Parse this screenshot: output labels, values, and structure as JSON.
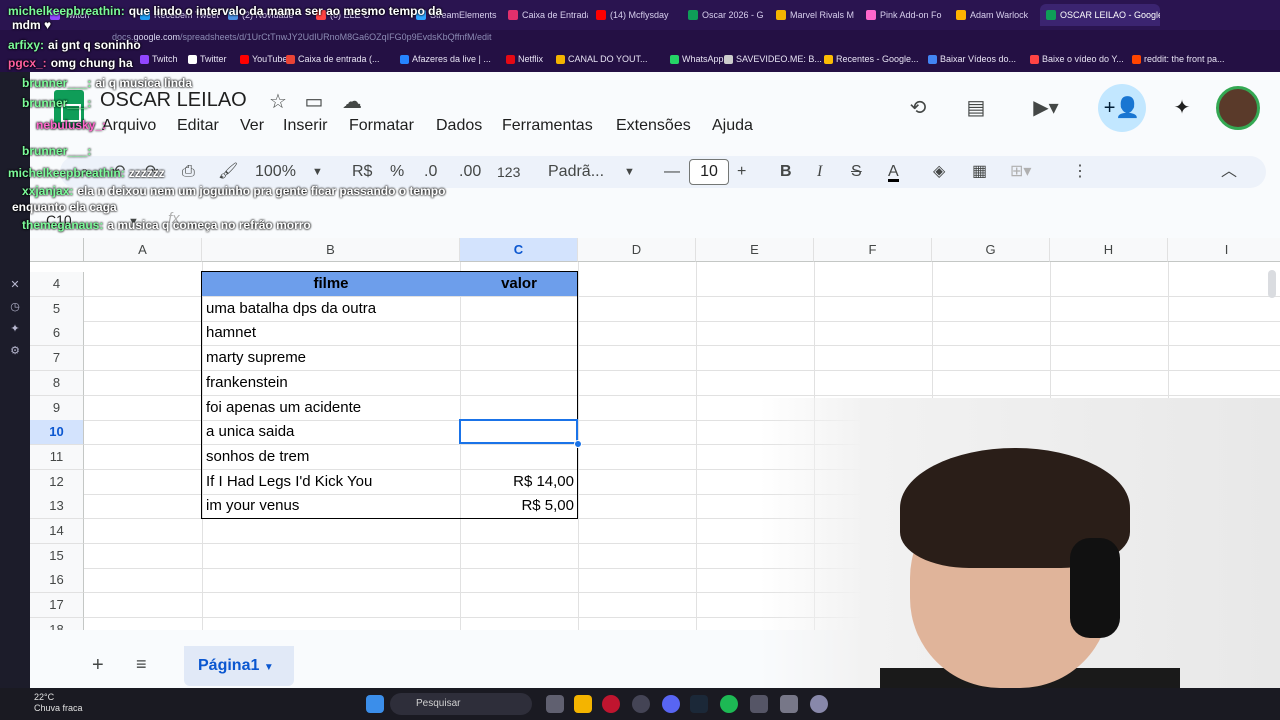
{
  "browser": {
    "tabs": [
      {
        "label": "Twitch",
        "color": "#9146ff"
      },
      {
        "label": "Recebem Tweet",
        "color": "#1d9bf0"
      },
      {
        "label": "(2) Novidade",
        "color": "#4a90e2"
      },
      {
        "label": "(6) ELE C",
        "color": "#ff4444"
      },
      {
        "label": "StreamElements",
        "color": "#2fa5ff"
      },
      {
        "label": "Caixa de Entrada",
        "color": "#e1306c"
      },
      {
        "label": "(14) Mcflysday",
        "color": "#ff0000"
      },
      {
        "label": "Oscar 2026 - G",
        "color": "#0f9d58"
      },
      {
        "label": "Marvel Rivals M",
        "color": "#f4b400"
      },
      {
        "label": "Pink Add-on Fo",
        "color": "#ff66cc"
      },
      {
        "label": "Adam Warlock",
        "color": "#ffb300"
      },
      {
        "label": "OSCAR LEILAO - Google",
        "color": "#0f9d58"
      }
    ],
    "url_prefix": "docs.",
    "url_domain": "google.com",
    "url_path": "/spreadsheets/d/1UrCtTnwJY2UdIURnoM8Ga6OZqIFG0p9EvdsKbQffnfM/edit",
    "bookmarks": [
      {
        "label": "Twitch",
        "color": "#9146ff"
      },
      {
        "label": "Twitter",
        "color": "#ffffff"
      },
      {
        "label": "YouTube",
        "color": "#ff0000"
      },
      {
        "label": "Caixa de entrada (...",
        "color": "#ea4335"
      },
      {
        "label": "Afazeres da live | ...",
        "color": "#2684ff"
      },
      {
        "label": "Netflix",
        "color": "#e50914"
      },
      {
        "label": "CANAL DO YOUT...",
        "color": "#f4b400"
      },
      {
        "label": "WhatsApp",
        "color": "#25d366"
      },
      {
        "label": "SAVEVIDEO.ME: B...",
        "color": "#cccccc"
      },
      {
        "label": "Recentes - Google...",
        "color": "#fbbc04"
      },
      {
        "label": "Baixar Vídeos do...",
        "color": "#4285f4"
      },
      {
        "label": "Baixe o vídeo do Y...",
        "color": "#ff4444"
      },
      {
        "label": "reddit: the front pa...",
        "color": "#ff4500"
      }
    ]
  },
  "sheets": {
    "title": "OSCAR LEILAO",
    "menu": [
      "Arquivo",
      "Editar",
      "Ver",
      "Inserir",
      "Formatar",
      "Dados",
      "Ferramentas",
      "Extensões",
      "Ajuda"
    ],
    "toolbar": {
      "zoom": "100%",
      "currency": "R$",
      "percent": "%",
      "dec_less": ".0",
      "dec_more": ".00",
      "number_fmt": "123",
      "font": "Padrã...",
      "font_size": "10"
    },
    "name_box": "C10",
    "fx": "fx",
    "columns": [
      "A",
      "B",
      "C",
      "D",
      "E",
      "F",
      "G",
      "H",
      "I"
    ],
    "selected_column": "C",
    "rows": [
      "4",
      "5",
      "6",
      "7",
      "8",
      "9",
      "10",
      "11",
      "12",
      "13",
      "14",
      "15",
      "16",
      "17",
      "18"
    ],
    "selected_row": "10",
    "table_header": {
      "filme": "filme",
      "valor": "valor"
    },
    "table_rows": [
      {
        "filme": "uma batalha dps da outra",
        "valor": ""
      },
      {
        "filme": "hamnet",
        "valor": ""
      },
      {
        "filme": "marty supreme",
        "valor": ""
      },
      {
        "filme": "frankenstein",
        "valor": ""
      },
      {
        "filme": "foi apenas um acidente",
        "valor": ""
      },
      {
        "filme": "a unica saida",
        "valor": ""
      },
      {
        "filme": "sonhos de trem",
        "valor": ""
      },
      {
        "filme": "If I Had Legs I'd Kick You",
        "valor": "R$ 14,00"
      },
      {
        "filme": "im your venus",
        "valor": "R$ 5,00"
      }
    ],
    "sheet_tab": "Página1"
  },
  "chat": [
    {
      "user": "michelkeepbreathin:",
      "message": "que lindo o intervalo da mama ser ao mesmo tempo da",
      "color": "#7cfc9a"
    },
    {
      "user": "",
      "message": "mdm ♥",
      "color": "#ffffff"
    },
    {
      "user": "arfixy:",
      "message": "ai gnt q soninho",
      "color": "#7cfc9a"
    },
    {
      "user": "pgcx_:",
      "message": "omg chung ha",
      "color": "#ff5f9e"
    },
    {
      "user": "brunner___:",
      "message": "ai q musica linda",
      "color": "#7cfc9a"
    },
    {
      "user": "brunner___:",
      "message": "",
      "color": "#7cfc9a"
    },
    {
      "user": "nebulusky_:",
      "message": "",
      "color": "#ff66cc"
    },
    {
      "user": "brunner___:",
      "message": "",
      "color": "#7cfc9a"
    },
    {
      "user": "michelkeepbreathin:",
      "message": "zzzzzz",
      "color": "#7cfc9a"
    },
    {
      "user": "xxjanjax:",
      "message": "ela n deixou nem um joguinho pra gente ficar passando o tempo",
      "color": "#7cfc9a"
    },
    {
      "user": "",
      "message": "enquanto ela caga",
      "color": "#ffffff"
    },
    {
      "user": "themeganaus:",
      "message": "a musica q começa no refrão morro",
      "color": "#7cfc9a"
    }
  ],
  "taskbar": {
    "temp": "22°C",
    "weather": "Chuva fraca",
    "search": "Pesquisar"
  },
  "colors": {
    "table_header_bg": "#6d9eeb",
    "selection": "#1a73e8",
    "share_bg": "#c2e7ff"
  }
}
